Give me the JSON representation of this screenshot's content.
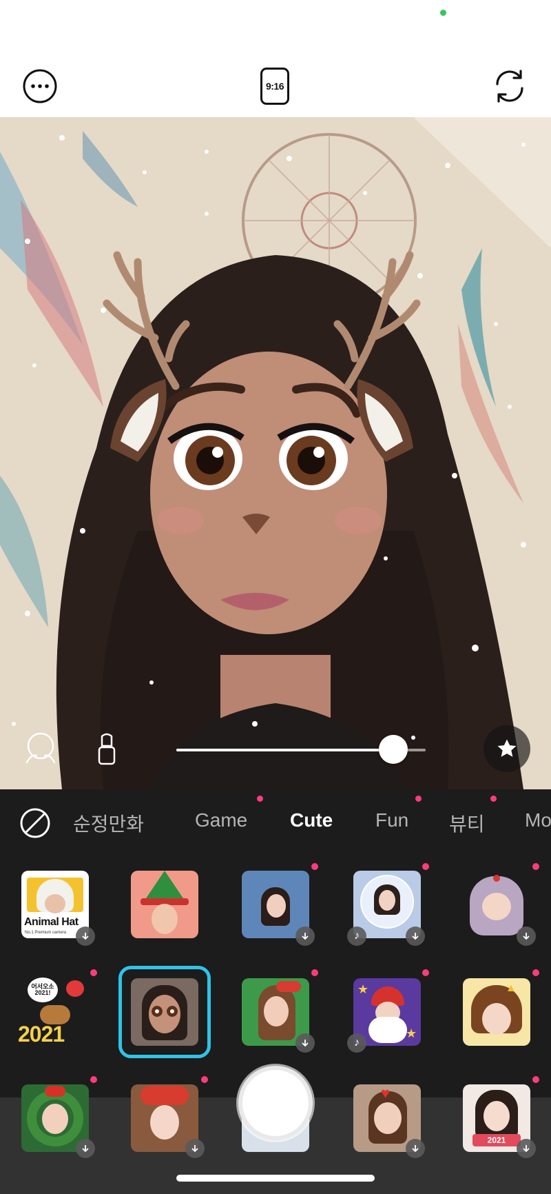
{
  "app": {
    "accent_color": "#2fc3e8",
    "badge_color": "#ff3b7f",
    "status_dot_color": "#34c759"
  },
  "topbar": {
    "more_icon": "more-horizontal-icon",
    "ratio_label": "9:16",
    "flip_icon": "camera-flip-icon"
  },
  "camera_controls": {
    "face_icon": "face-shape-icon",
    "makeup_icon": "lipstick-icon",
    "intensity": 0.87,
    "favorite_icon": "star-icon"
  },
  "tabs": [
    {
      "label": "순정만화",
      "active": false
    },
    {
      "label": "Game",
      "active": false
    },
    {
      "label": "Cute",
      "active": true
    },
    {
      "label": "Fun",
      "active": false
    },
    {
      "label": "뷰티",
      "active": false
    },
    {
      "label": "Mo",
      "active": false
    }
  ],
  "stickers": {
    "animal_hat_title": "Animal Hat",
    "animal_hat_sub": "No.1 Premium camera",
    "new_year_sticker_text": "2021",
    "new_year_bubble": "어서오소 2021!",
    "cow_sign_text": "2021",
    "selected_index": 6
  }
}
